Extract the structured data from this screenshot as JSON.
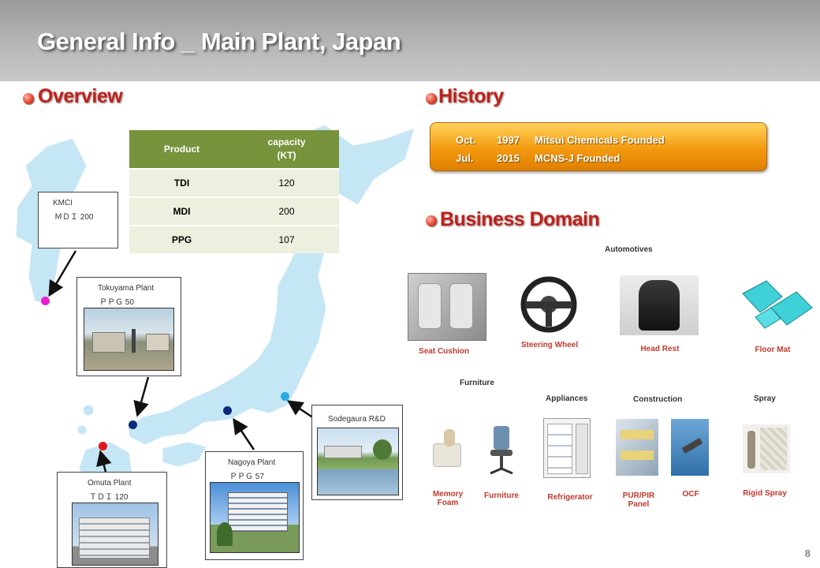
{
  "header": {
    "title": "General Info _ Main Plant, Japan"
  },
  "overview": {
    "title": "Overview",
    "table": {
      "headers": {
        "product": "Product",
        "capacity_line1": "capacity",
        "capacity_line2": "(KT)"
      },
      "rows": [
        {
          "product": "TDI",
          "capacity": "120"
        },
        {
          "product": "MDI",
          "capacity": "200"
        },
        {
          "product": "PPG",
          "capacity": "107"
        }
      ]
    },
    "plants": {
      "kmci": {
        "name": "KMCI",
        "detail": "ＭＤＩ 200"
      },
      "tokuyama": {
        "name": "Tokuyama Plant",
        "detail": "ＰＰＧ  50"
      },
      "omuta": {
        "name": "Omuta Plant",
        "detail": "ＴＤＩ  120"
      },
      "nagoya": {
        "name": "Nagoya Plant",
        "detail": "ＰＰＧ  57"
      },
      "sodegaura": {
        "name": "Sodegaura R&D"
      }
    },
    "colors": {
      "land": "#c5e6f5",
      "dot_magenta": "#e81fd0",
      "dot_navy": "#0d2a7e",
      "dot_red": "#e3141b",
      "dot_sky": "#2aa8e0",
      "table_header": "#77933c",
      "table_row": "#ebf1de"
    }
  },
  "history": {
    "title": "History",
    "events": [
      {
        "month": "Oct.",
        "year": "1997",
        "text": "Mitsui Chemicals Founded"
      },
      {
        "month": "Jul.",
        "year": "2015",
        "text": "MCNS-J Founded"
      }
    ]
  },
  "business": {
    "title": "Business Domain",
    "categories": {
      "automotives": "Automotives",
      "furniture": "Furniture",
      "appliances": "Appliances",
      "construction": "Construction",
      "spray": "Spray"
    },
    "items": {
      "seat_cushion": "Seat Cushion",
      "steering_wheel": "Steering Wheel",
      "head_rest": "Head Rest",
      "floor_mat": "Floor Mat",
      "memory_foam_1": "Memory",
      "memory_foam_2": "Foam",
      "furniture": "Furniture",
      "refrigerator": "Refrigerator",
      "pur_pir_1": "PUR/PIR",
      "pur_pir_2": "Panel",
      "ocf": "OCF",
      "rigid_spray": "Rigid Spray"
    }
  },
  "page_number": "8"
}
